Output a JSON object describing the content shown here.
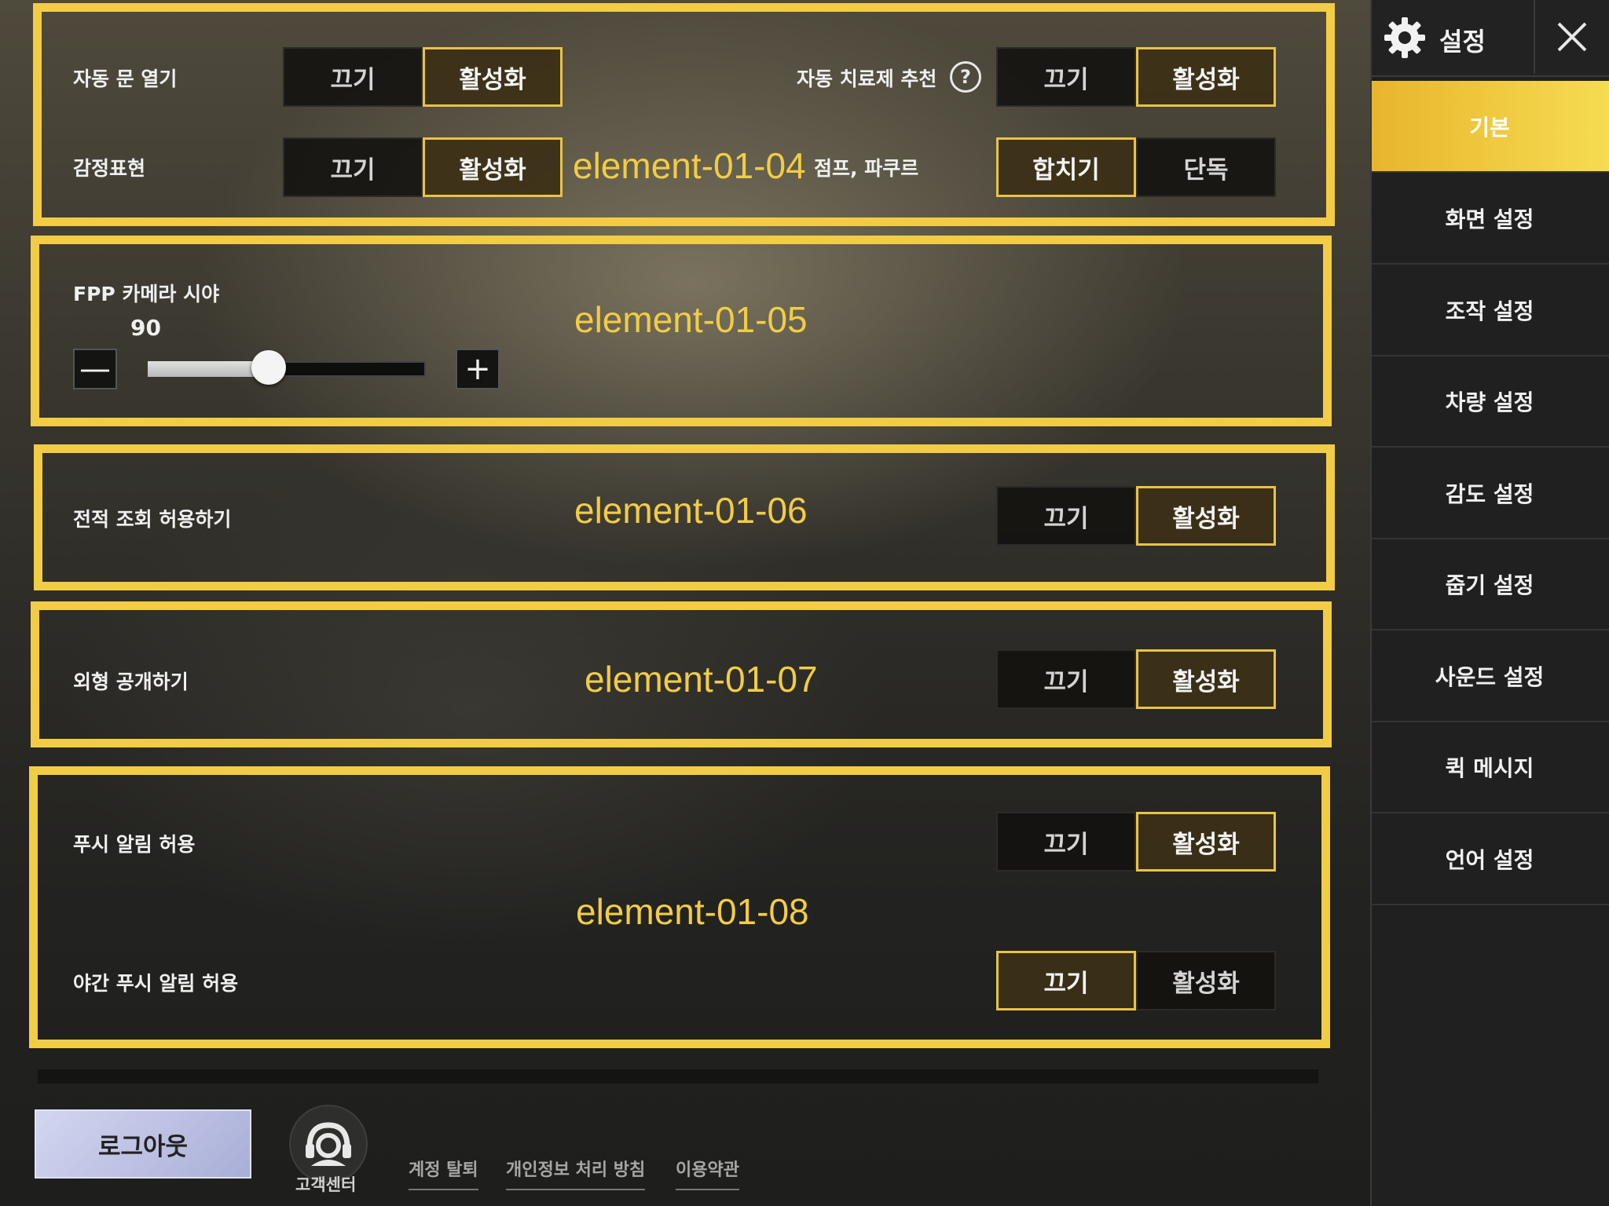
{
  "panels": {
    "p04": {
      "overlay": "element-01-04",
      "auto_door": {
        "label": "자동 문 열기",
        "off": "끄기",
        "on": "활성화"
      },
      "auto_heal": {
        "label": "자동 치료제 추천",
        "help": "?",
        "off": "끄기",
        "on": "활성화"
      },
      "emote": {
        "label": "감정표현",
        "off": "끄기",
        "on": "활성화"
      },
      "jump": {
        "label": "점프, 파쿠르",
        "combine": "합치기",
        "single": "단독"
      }
    },
    "p05": {
      "overlay": "element-01-05",
      "fov_label": "FPP 카메라 시야",
      "fov_value": "90",
      "fov_fraction": 0.44,
      "minus": "—",
      "plus": "+"
    },
    "p06": {
      "overlay": "element-01-06",
      "stats": {
        "label": "전적 조회 허용하기",
        "off": "끄기",
        "on": "활성화"
      }
    },
    "p07": {
      "overlay": "element-01-07",
      "appearance": {
        "label": "외형 공개하기",
        "off": "끄기",
        "on": "활성화"
      }
    },
    "p08": {
      "overlay": "element-01-08",
      "push": {
        "label": "푸시 알림 허용",
        "off": "끄기",
        "on": "활성화"
      },
      "night_push": {
        "label": "야간 푸시 알림 허용",
        "off": "끄기",
        "on": "활성화"
      }
    }
  },
  "footer": {
    "logout": "로그아웃",
    "support": "고객센터",
    "links": [
      "계정 탈퇴",
      "개인정보 처리 방침",
      "이용약관"
    ]
  },
  "sidebar": {
    "title": "설정",
    "items": [
      "기본",
      "화면 설정",
      "조작 설정",
      "차량 설정",
      "감도 설정",
      "줍기 설정",
      "사운드 설정",
      "퀵 메시지",
      "언어 설정"
    ],
    "active": 0
  },
  "colors": {
    "accent": "#f2cc45",
    "active_tab": "#f0c43c",
    "logout_button": "#b9bddf"
  },
  "icons": {
    "settings": "gear-icon",
    "close": "close-icon",
    "help": "help-icon",
    "support": "headset-icon"
  }
}
